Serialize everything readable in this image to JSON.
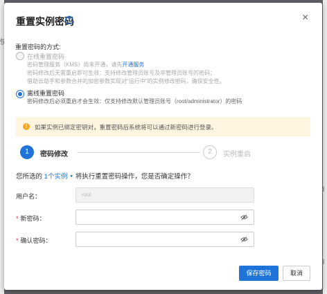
{
  "background": {
    "left_char": "快",
    "right_char_1": "l",
    "right_char_2": "l"
  },
  "dialog": {
    "title": "重置实例密码",
    "help_icon": "?",
    "close_icon": "×"
  },
  "methods": {
    "label": "重置密码的方式:",
    "online": {
      "title": "在线重置密码",
      "desc1_prefix": "密码管理服务（KMS）尚未开通，请先",
      "desc1_link": "开通服务",
      "desc2": "密码修改后无需重启即可生效：支持修改管理员账号及非管理员账号的密码；",
      "desc3": "借助云助手和参数合并的加密参数实现对\"运行中\"的实例修改密码，确保安全性。"
    },
    "offline": {
      "title": "离线重置密码",
      "desc": "密码修改后必须重启才会生效：仅支持修改默认管理员账号（root/administrator）的密码"
    }
  },
  "alert": {
    "icon": "!",
    "text": "如果实例已绑定密钥对，重置密码后系统将可以通过新密码进行登录。"
  },
  "steps": [
    {
      "num": "1",
      "label": "密码修改"
    },
    {
      "num": "2",
      "label": "实例重启"
    }
  ],
  "confirm": {
    "prefix": "您所选的",
    "link": "1个实例",
    "caret": "▼",
    "suffix": "将执行重置密码操作，您是否确定操作？"
  },
  "form": {
    "username_label": "用户名：",
    "username_value": "root",
    "new_password_label": "新密码：",
    "confirm_password_label": "确认密码：",
    "required_mark": "*"
  },
  "buttons": {
    "save": "保存密码",
    "cancel": "取消"
  },
  "colors": {
    "accent": "#1e74d8",
    "warning_bg": "#fff5e0",
    "warning_icon": "#f5a623",
    "required": "#e0302e"
  }
}
